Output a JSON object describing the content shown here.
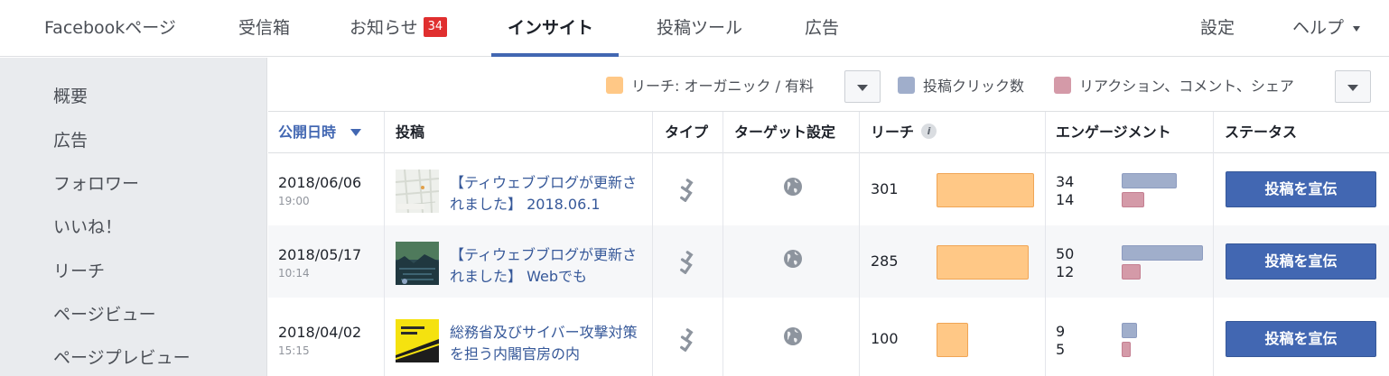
{
  "topnav": {
    "facebook_page": "Facebookページ",
    "inbox": "受信箱",
    "notifications": "お知らせ",
    "notifications_count": "34",
    "insights": "インサイト",
    "publishing_tools": "投稿ツール",
    "ads": "広告",
    "settings": "設定",
    "help": "ヘルプ"
  },
  "sidebar": {
    "items": [
      {
        "label": "概要"
      },
      {
        "label": "広告"
      },
      {
        "label": "フォロワー"
      },
      {
        "label": "いいね！"
      },
      {
        "label": "リーチ"
      },
      {
        "label": "ページビュー"
      },
      {
        "label": "ページプレビュー"
      }
    ]
  },
  "legend": {
    "reach": "リーチ: オーガニック / 有料",
    "post_clicks": "投稿クリック数",
    "reactions": "リアクション、コメント、シェア",
    "colors": {
      "reach": "#ffc886",
      "post_clicks": "#a0aecb",
      "reactions": "#d49aa8"
    }
  },
  "table": {
    "headers": {
      "published": "公開日時",
      "post": "投稿",
      "type": "タイプ",
      "targeting": "ターゲット設定",
      "reach": "リーチ",
      "engagement": "エンゲージメント",
      "status": "ステータス"
    },
    "rows": [
      {
        "date": "2018/06/06",
        "time": "19:00",
        "title": "【ティウェブブログが更新されました】 2018.06.1",
        "reach": "301",
        "clicks": "34",
        "reactions": "14",
        "boost": "投稿を宣伝"
      },
      {
        "date": "2018/05/17",
        "time": "10:14",
        "title": "【ティウェブブログが更新されました】 Webでも",
        "reach": "285",
        "clicks": "50",
        "reactions": "12",
        "boost": "投稿を宣伝"
      },
      {
        "date": "2018/04/02",
        "time": "15:15",
        "title": "総務省及びサイバー攻撃対策を担う内閣官房の内",
        "reach": "100",
        "clicks": "9",
        "reactions": "5",
        "boost": "投稿を宣伝"
      }
    ]
  },
  "accent_color": "#4267b2"
}
